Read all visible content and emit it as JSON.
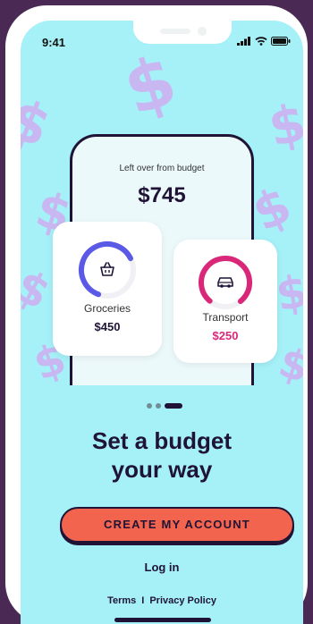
{
  "status_bar": {
    "time": "9:41"
  },
  "mock_phone": {
    "caption": "Left over from budget",
    "amount": "$745"
  },
  "cards": [
    {
      "label": "Groceries",
      "amount": "$450",
      "icon": "basket-icon",
      "color": "#5a5ae6",
      "progress": 0.62
    },
    {
      "label": "Transport",
      "amount": "$250",
      "icon": "car-icon",
      "color": "#d9287a",
      "progress": 0.78
    }
  ],
  "pagination": {
    "total": 3,
    "active": 3
  },
  "headline": {
    "line1": "Set a budget",
    "line2": "your way"
  },
  "cta": {
    "label": "CREATE MY ACCOUNT",
    "color": "#f2644e"
  },
  "login": {
    "label": "Log in"
  },
  "footer": {
    "terms": "Terms",
    "separator": "I",
    "privacy": "Privacy Policy"
  },
  "colors": {
    "background": "#a6f0f8",
    "accent_text": "#1f1436",
    "frame": "#4a2a55"
  }
}
